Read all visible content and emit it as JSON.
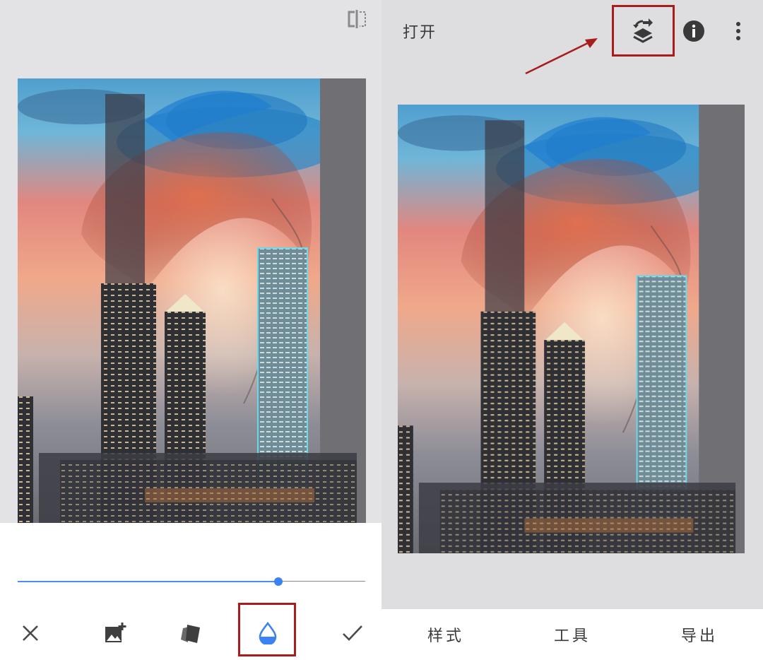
{
  "colors": {
    "accent_blue": "#3b82f2",
    "annotation_red": "#a81c1c",
    "panel_gray": "#e3e3e5",
    "text_dark": "#3a3a3a"
  },
  "left_editor": {
    "compare_icon": "compare-split-icon",
    "photo": "double-exposure-portrait-city",
    "opacity_slider": {
      "value": 0.75
    },
    "toolbar": [
      {
        "icon": "close-icon"
      },
      {
        "icon": "add-image-icon"
      },
      {
        "icon": "blend-styles-icon"
      },
      {
        "icon": "opacity-drop-icon",
        "highlighted": true
      },
      {
        "icon": "check-icon"
      }
    ]
  },
  "right_main": {
    "header": {
      "open_label": "打开",
      "stack_icon": "stack-edits-icon",
      "info_icon": "info-icon",
      "more_icon": "more-vert-icon"
    },
    "photo": "double-exposure-portrait-city",
    "bottom_nav": {
      "styles": "样式",
      "tools": "工具",
      "export": "导出"
    }
  }
}
